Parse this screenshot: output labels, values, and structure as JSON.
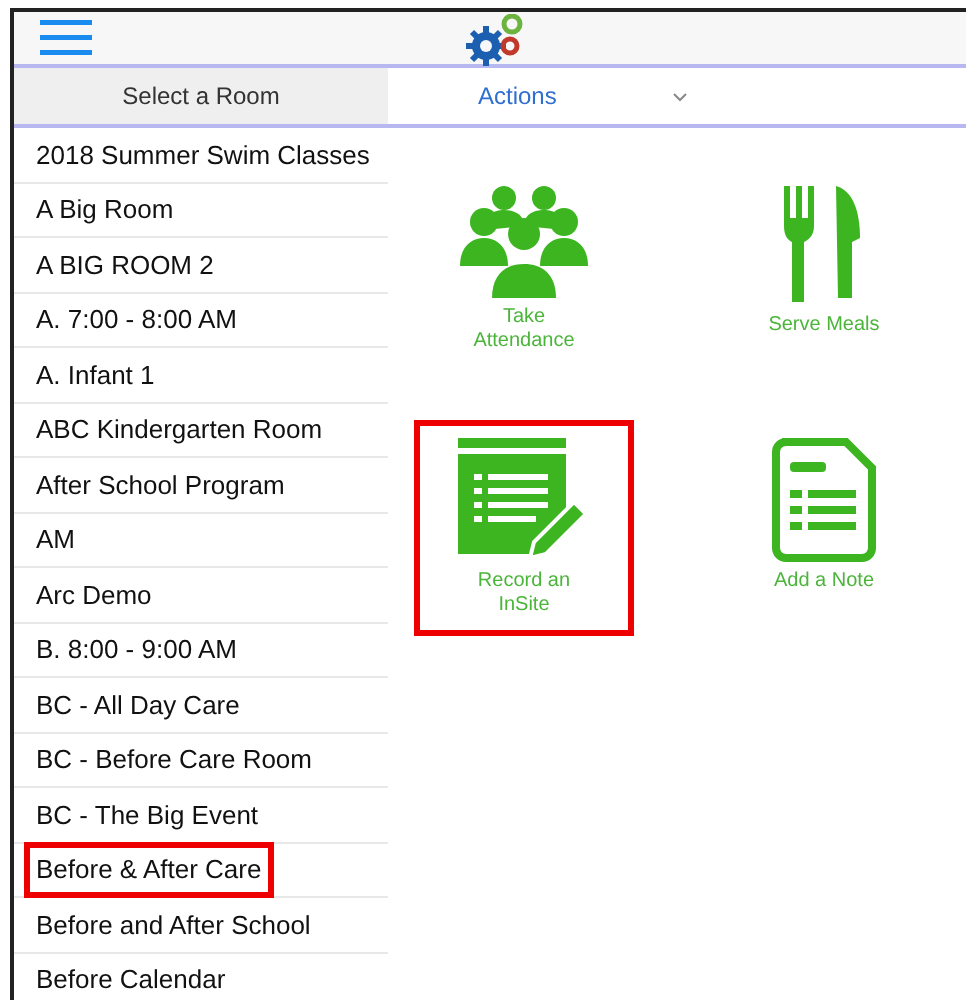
{
  "header": {
    "room_label": "Select a Room",
    "actions_label": "Actions"
  },
  "rooms": [
    {
      "name": "2018 Summer Swim Classes",
      "highlighted": false
    },
    {
      "name": "A Big Room",
      "highlighted": false
    },
    {
      "name": "A BIG ROOM 2",
      "highlighted": false
    },
    {
      "name": "A. 7:00 - 8:00 AM",
      "highlighted": false
    },
    {
      "name": "A. Infant 1",
      "highlighted": false
    },
    {
      "name": "ABC Kindergarten Room",
      "highlighted": false
    },
    {
      "name": "After School Program",
      "highlighted": false
    },
    {
      "name": "AM",
      "highlighted": false
    },
    {
      "name": "Arc Demo",
      "highlighted": false
    },
    {
      "name": "B. 8:00 - 9:00 AM",
      "highlighted": false
    },
    {
      "name": "BC - All Day Care",
      "highlighted": false
    },
    {
      "name": "BC - Before Care Room",
      "highlighted": false
    },
    {
      "name": "BC - The Big Event",
      "highlighted": false
    },
    {
      "name": "Before & After Care",
      "highlighted": true
    },
    {
      "name": "Before and After School",
      "highlighted": false
    },
    {
      "name": "Before Calendar",
      "highlighted": false
    }
  ],
  "actions": [
    {
      "kind": "attendance",
      "label": "Take Attendance",
      "highlighted": false
    },
    {
      "kind": "meals",
      "label": "Serve Meals",
      "highlighted": false
    },
    {
      "kind": "insite",
      "label": "Record an InSite",
      "highlighted": true
    },
    {
      "kind": "note",
      "label": "Add a Note",
      "highlighted": false
    }
  ]
}
